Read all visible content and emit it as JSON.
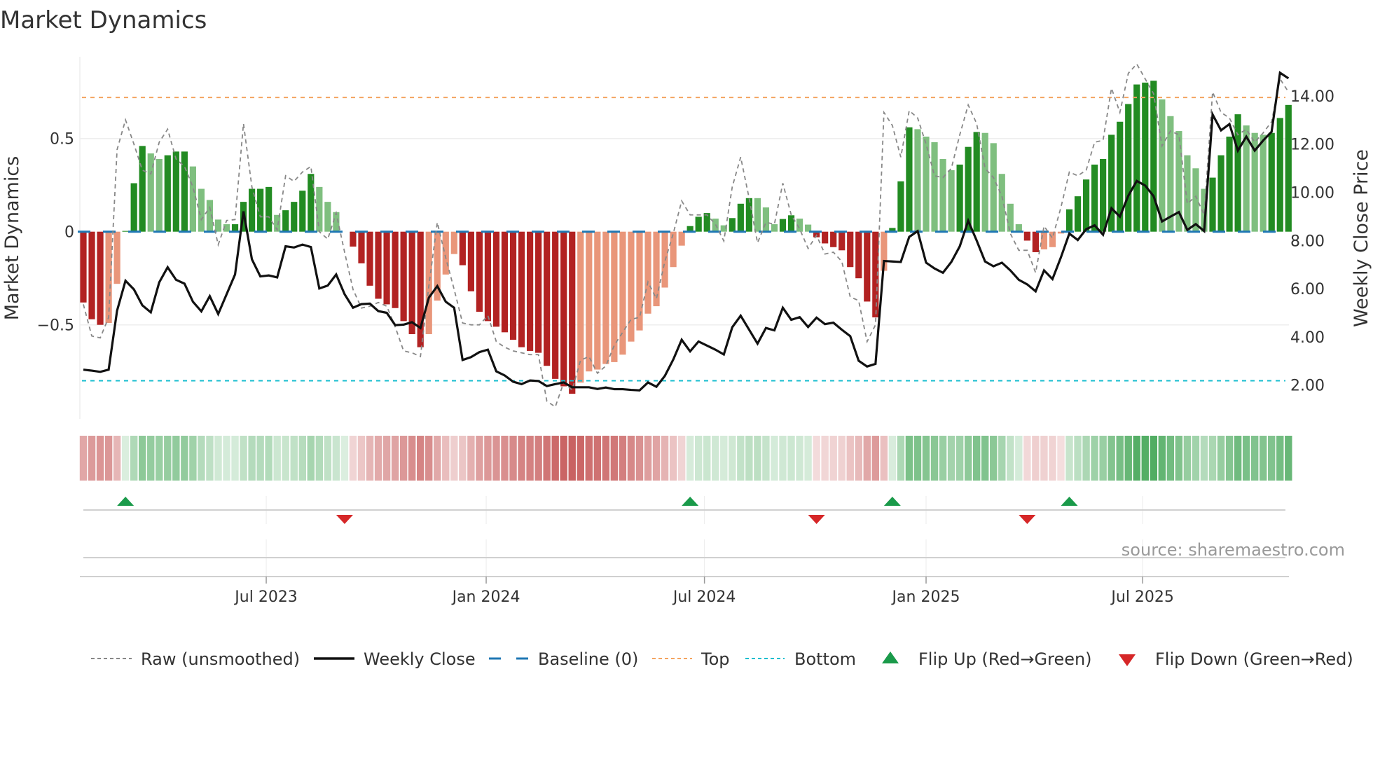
{
  "title": "Market Dynamics",
  "source": "source: sharemaestro.com",
  "colors": {
    "dark_green": "#228b22",
    "light_green": "#7fbf7f",
    "dark_red": "#b22222",
    "light_red": "#e9967a",
    "baseline": "#1f77b4",
    "top": "#f4a460",
    "bottom": "#17becf",
    "flip_up": "#1a9a4a",
    "flip_down": "#d62728",
    "close": "#111111",
    "raw": "#888888"
  },
  "legend": {
    "raw": "Raw (unsmoothed)",
    "close": "Weekly Close",
    "baseline": "Baseline (0)",
    "top": "Top",
    "bottom": "Bottom",
    "flip_up": "Flip Up (Red→Green)",
    "flip_down": "Flip Down (Green→Red)"
  },
  "chart_data": {
    "type": "bar",
    "title": "Market Dynamics",
    "xlabel": "",
    "ylabel": "Market Dynamics",
    "y2label": "Weekly Close Price",
    "ylim": [
      -0.95,
      0.95
    ],
    "y2lim": [
      1.0,
      15.2
    ],
    "yticks": [
      {
        "v": 0.5,
        "label": "0.5"
      },
      {
        "v": 0,
        "label": "0"
      },
      {
        "v": -0.5,
        "label": "−0.5"
      }
    ],
    "y2ticks": [
      {
        "v": 14,
        "label": "14.00"
      },
      {
        "v": 12,
        "label": "12.00"
      },
      {
        "v": 10,
        "label": "10.00"
      },
      {
        "v": 8,
        "label": "8.00"
      },
      {
        "v": 6,
        "label": "6.00"
      },
      {
        "v": 4,
        "label": "4.00"
      },
      {
        "v": 2,
        "label": "2.00"
      }
    ],
    "xticks": [
      {
        "week": 21.7,
        "label": "Jul 2023"
      },
      {
        "week": 47.8,
        "label": "Jan 2024"
      },
      {
        "week": 73.7,
        "label": "Jul 2024"
      },
      {
        "week": 100.0,
        "label": "Jan 2025"
      },
      {
        "week": 125.7,
        "label": "Jul 2025"
      }
    ],
    "top_level": 0.72,
    "bottom_level": -0.8,
    "baseline": 0,
    "momentum": [
      -0.38,
      -0.47,
      -0.5,
      -0.49,
      -0.28,
      0.004,
      0.26,
      0.46,
      0.42,
      0.39,
      0.41,
      0.43,
      0.43,
      0.35,
      0.23,
      0.17,
      0.065,
      0.04,
      0.04,
      0.16,
      0.23,
      0.23,
      0.24,
      0.09,
      0.115,
      0.16,
      0.22,
      0.31,
      0.24,
      0.16,
      0.105,
      0,
      -0.08,
      -0.17,
      -0.29,
      -0.36,
      -0.39,
      -0.41,
      -0.48,
      -0.55,
      -0.62,
      -0.55,
      -0.37,
      -0.23,
      -0.12,
      -0.18,
      -0.32,
      -0.43,
      -0.48,
      -0.51,
      -0.54,
      -0.58,
      -0.62,
      -0.64,
      -0.65,
      -0.72,
      -0.79,
      -0.83,
      -0.87,
      -0.81,
      -0.75,
      -0.74,
      -0.71,
      -0.7,
      -0.66,
      -0.59,
      -0.53,
      -0.44,
      -0.4,
      -0.3,
      -0.19,
      -0.075,
      0.03,
      0.08,
      0.1,
      0.07,
      0.034,
      0.073,
      0.15,
      0.18,
      0.18,
      0.13,
      0.04,
      0.068,
      0.088,
      0.07,
      0.038,
      -0.03,
      -0.063,
      -0.083,
      -0.1,
      -0.19,
      -0.25,
      -0.375,
      -0.46,
      -0.21,
      0.02,
      0.27,
      0.56,
      0.55,
      0.51,
      0.48,
      0.39,
      0.33,
      0.36,
      0.455,
      0.535,
      0.53,
      0.475,
      0.31,
      0.15,
      0.04,
      -0.048,
      -0.11,
      -0.095,
      -0.083,
      -0.01,
      0.12,
      0.19,
      0.28,
      0.36,
      0.39,
      0.52,
      0.59,
      0.685,
      0.79,
      0.8,
      0.81,
      0.71,
      0.62,
      0.54,
      0.41,
      0.34,
      0.23,
      0.29,
      0.41,
      0.51,
      0.63,
      0.57,
      0.53,
      0.52,
      0.53,
      0.61,
      0.68
    ],
    "shade": "DDDLLDDDLLDDDLLLLLDDDDDLDDDDLLLDDDDDDDDDDLLLLDDDDDDDDDDDDDDLLLLLLLLLLLLLDDDLLDDDLLLDDLLDDDDDDDDLDDDLLLLLDDDLLLLLDDLLLDDDDDDDDDDDLLLLLLDDDDLLLDDD",
    "raw": [
      -0.39,
      -0.56,
      -0.57,
      -0.46,
      0.44,
      0.6,
      0.47,
      0.33,
      0.31,
      0.48,
      0.55,
      0.39,
      0.35,
      0.24,
      0.065,
      0.13,
      -0.07,
      0.06,
      0.065,
      0.58,
      0.24,
      0.08,
      0.08,
      0.01,
      0.3,
      0.27,
      0.32,
      0.35,
      0.0,
      -0.04,
      0.1,
      -0.11,
      -0.31,
      -0.41,
      -0.4,
      -0.38,
      -0.4,
      -0.51,
      -0.64,
      -0.65,
      -0.67,
      -0.29,
      0.05,
      -0.14,
      -0.31,
      -0.49,
      -0.5,
      -0.5,
      -0.45,
      -0.59,
      -0.62,
      -0.64,
      -0.65,
      -0.66,
      -0.66,
      -0.91,
      -0.94,
      -0.81,
      -0.85,
      -0.69,
      -0.67,
      -0.76,
      -0.72,
      -0.61,
      -0.54,
      -0.47,
      -0.46,
      -0.27,
      -0.36,
      -0.16,
      -0.01,
      0.165,
      0.09,
      0.09,
      0.09,
      0.04,
      -0.05,
      0.24,
      0.4,
      0.18,
      -0.06,
      0.05,
      0.04,
      0.26,
      0.09,
      0.015,
      -0.09,
      -0.02,
      -0.12,
      -0.11,
      -0.16,
      -0.35,
      -0.37,
      -0.59,
      -0.5,
      0.64,
      0.57,
      0.4,
      0.65,
      0.61,
      0.47,
      0.3,
      0.29,
      0.34,
      0.52,
      0.68,
      0.58,
      0.34,
      0.29,
      0.19,
      -0.01,
      -0.1,
      -0.1,
      -0.22,
      0.03,
      -0.035,
      0.13,
      0.32,
      0.3,
      0.33,
      0.48,
      0.49,
      0.77,
      0.64,
      0.85,
      0.9,
      0.82,
      0.74,
      0.46,
      0.54,
      0.52,
      0.15,
      0.19,
      0.09,
      0.75,
      0.64,
      0.61,
      0.52,
      0.55,
      0.48,
      0.53,
      0.59,
      0.82,
      0.75
    ],
    "close": [
      2.64,
      2.6,
      2.55,
      2.64,
      5.09,
      6.33,
      5.97,
      5.31,
      5.02,
      6.26,
      6.89,
      6.37,
      6.21,
      5.46,
      5.06,
      5.69,
      4.95,
      5.77,
      6.59,
      9.21,
      7.22,
      6.51,
      6.55,
      6.47,
      7.76,
      7.71,
      7.83,
      7.73,
      6.01,
      6.13,
      6.59,
      5.77,
      5.21,
      5.36,
      5.38,
      5.07,
      5.0,
      4.49,
      4.51,
      4.61,
      4.37,
      5.63,
      6.11,
      5.46,
      5.21,
      3.04,
      3.16,
      3.37,
      3.47,
      2.57,
      2.4,
      2.14,
      2.04,
      2.19,
      2.17,
      1.96,
      2.04,
      2.11,
      1.91,
      1.91,
      1.91,
      1.84,
      1.9,
      1.83,
      1.83,
      1.8,
      1.78,
      2.11,
      1.93,
      2.38,
      3.06,
      3.88,
      3.4,
      3.81,
      3.64,
      3.47,
      3.27,
      4.4,
      4.88,
      4.3,
      3.72,
      4.37,
      4.27,
      5.21,
      4.71,
      4.82,
      4.41,
      4.8,
      4.53,
      4.59,
      4.3,
      4.03,
      3.01,
      2.77,
      2.88,
      7.15,
      7.13,
      7.11,
      8.15,
      8.39,
      7.08,
      6.84,
      6.66,
      7.11,
      7.76,
      8.82,
      8.0,
      7.13,
      6.93,
      7.08,
      6.76,
      6.37,
      6.18,
      5.89,
      6.76,
      6.4,
      7.3,
      8.29,
      8.02,
      8.47,
      8.63,
      8.24,
      9.34,
      8.99,
      9.86,
      10.47,
      10.28,
      9.84,
      8.79,
      8.99,
      9.18,
      8.44,
      8.68,
      8.39,
      13.23,
      12.57,
      12.83,
      11.73,
      12.31,
      11.73,
      12.15,
      12.51,
      14.96,
      14.73
    ],
    "flips_up": [
      5,
      72,
      96,
      117
    ],
    "flips_down": [
      31,
      87,
      112
    ],
    "legend_position": "bottom"
  }
}
